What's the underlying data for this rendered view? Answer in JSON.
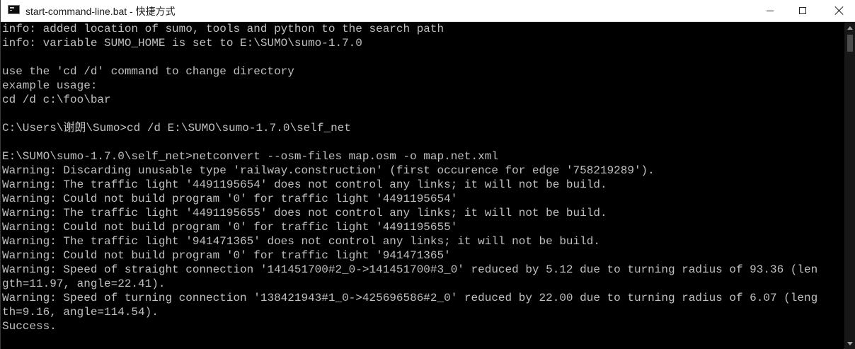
{
  "window": {
    "title": "start-command-line.bat - 快捷方式",
    "icon": "console-app-icon",
    "controls": [
      "minimize-icon",
      "maximize-icon",
      "close-icon"
    ]
  },
  "console": {
    "text_color": "#c0c0c0",
    "background": "#000000",
    "lines": [
      "info: added location of sumo, tools and python to the search path",
      "info: variable SUMO_HOME is set to E:\\SUMO\\sumo-1.7.0",
      "",
      "use the 'cd /d' command to change directory",
      "example usage:",
      "cd /d c:\\foo\\bar",
      "",
      "C:\\Users\\谢朗\\Sumo>cd /d E:\\SUMO\\sumo-1.7.0\\self_net",
      "",
      "E:\\SUMO\\sumo-1.7.0\\self_net>netconvert --osm-files map.osm -o map.net.xml",
      "Warning: Discarding unusable type 'railway.construction' (first occurence for edge '758219289').",
      "Warning: The traffic light '4491195654' does not control any links; it will not be build.",
      "Warning: Could not build program '0' for traffic light '4491195654'",
      "Warning: The traffic light '4491195655' does not control any links; it will not be build.",
      "Warning: Could not build program '0' for traffic light '4491195655'",
      "Warning: The traffic light '941471365' does not control any links; it will not be build.",
      "Warning: Could not build program '0' for traffic light '941471365'",
      "Warning: Speed of straight connection '141451700#2_0->141451700#3_0' reduced by 5.12 due to turning radius of 93.36 (len",
      "gth=11.97, angle=22.41).",
      "Warning: Speed of turning connection '138421943#1_0->425696586#2_0' reduced by 22.00 due to turning radius of 6.07 (leng",
      "th=9.16, angle=114.54).",
      "Success."
    ]
  }
}
